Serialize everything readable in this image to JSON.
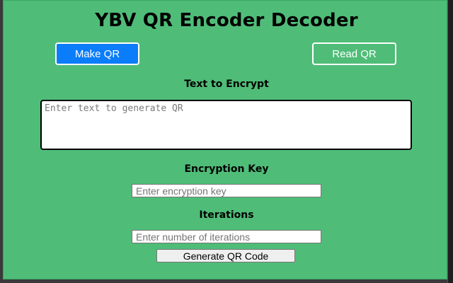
{
  "app": {
    "title": "YBV QR Encoder Decoder"
  },
  "mode_buttons": {
    "make_label": "Make QR",
    "read_label": "Read QR"
  },
  "encrypt_section": {
    "text_label": "Text to Encrypt",
    "text_placeholder": "Enter text to generate QR",
    "text_value": "",
    "key_label": "Encryption Key",
    "key_placeholder": "Enter encryption key",
    "key_value": "",
    "iterations_label": "Iterations",
    "iterations_placeholder": "Enter number of iterations",
    "iterations_value": ""
  },
  "actions": {
    "generate_label": "Generate QR Code"
  },
  "colors": {
    "panel_background": "#4fbd78",
    "primary_button": "#0b7dfa",
    "button_text": "#ffffff",
    "heading_text": "#000000"
  }
}
